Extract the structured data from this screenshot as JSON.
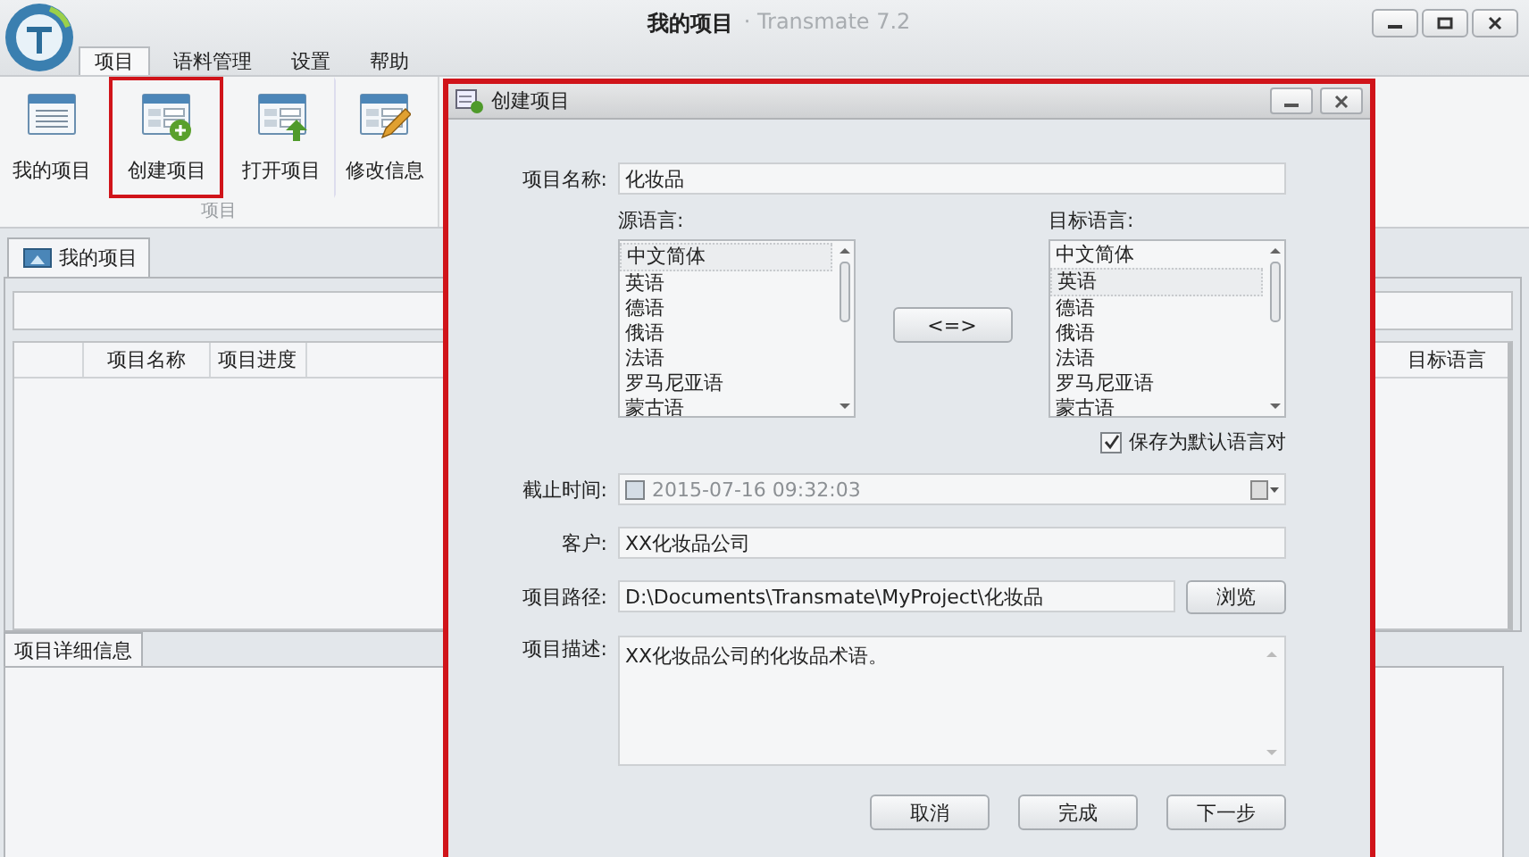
{
  "window": {
    "title": "我的项目",
    "app_name": "· Transmate 7.2"
  },
  "menu_tabs": [
    {
      "label": "项目",
      "selected": true
    },
    {
      "label": "语料管理",
      "selected": false
    },
    {
      "label": "设置",
      "selected": false
    },
    {
      "label": "帮助",
      "selected": false
    }
  ],
  "toolbar": {
    "group_label": "项目",
    "items": [
      {
        "label": "我的项目",
        "kind": "list",
        "highlighted": false
      },
      {
        "label": "创建项目",
        "kind": "new",
        "highlighted": true
      },
      {
        "label": "打开项目",
        "kind": "open",
        "highlighted": false
      },
      {
        "label": "修改信息",
        "kind": "edit",
        "highlighted": false
      }
    ]
  },
  "project_tab": {
    "label": "我的项目"
  },
  "table": {
    "columns": [
      {
        "label": "项目名称"
      },
      {
        "label": "项目进度"
      },
      {
        "label": "目标语言"
      }
    ]
  },
  "detail_tab": {
    "label": "项目详细信息"
  },
  "dialog": {
    "title": "创建项目",
    "highlighted": true,
    "project_name": {
      "label": "项目名称:",
      "value": "化妆品"
    },
    "source_language": {
      "label": "源语言:",
      "options": [
        {
          "label": "中文简体",
          "selected": true
        },
        {
          "label": "英语",
          "selected": false
        },
        {
          "label": "德语",
          "selected": false
        },
        {
          "label": "俄语",
          "selected": false
        },
        {
          "label": "法语",
          "selected": false
        },
        {
          "label": "罗马尼亚语",
          "selected": false
        },
        {
          "label": "蒙古语",
          "selected": false
        }
      ]
    },
    "swap_button": "<=>",
    "target_language": {
      "label": "目标语言:",
      "options": [
        {
          "label": "中文简体",
          "selected": false
        },
        {
          "label": "英语",
          "selected": true
        },
        {
          "label": "德语",
          "selected": false
        },
        {
          "label": "俄语",
          "selected": false
        },
        {
          "label": "法语",
          "selected": false
        },
        {
          "label": "罗马尼亚语",
          "selected": false
        },
        {
          "label": "蒙古语",
          "selected": false
        }
      ]
    },
    "save_default": {
      "label": "保存为默认语言对",
      "checked": true
    },
    "deadline": {
      "label": "截止时间:",
      "value": "2015-07-16 09:32:03",
      "checked": false
    },
    "client": {
      "label": "客户:",
      "value": "XX化妆品公司"
    },
    "path": {
      "label": "项目路径:",
      "value": "D:\\Documents\\Transmate\\MyProject\\化妆品",
      "browse_button": "浏览"
    },
    "description": {
      "label": "项目描述:",
      "value": "XX化妆品公司的化妆品术语。"
    },
    "buttons": [
      {
        "label": "取消"
      },
      {
        "label": "完成"
      },
      {
        "label": "下一步"
      }
    ]
  }
}
